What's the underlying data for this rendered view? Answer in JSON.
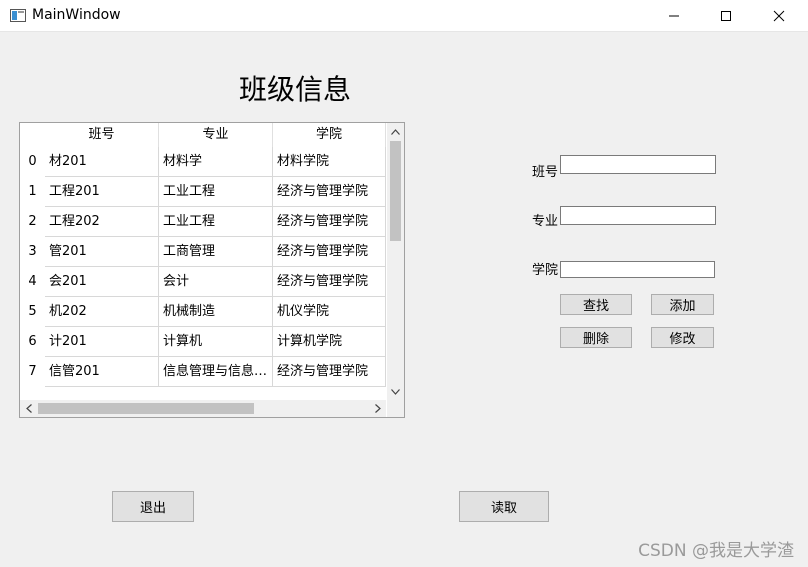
{
  "window": {
    "title": "MainWindow"
  },
  "heading": "班级信息",
  "table": {
    "headers": [
      "班号",
      "专业",
      "学院"
    ],
    "rows": [
      {
        "index": "0",
        "cells": [
          "材201",
          "材料学",
          "材料学院"
        ]
      },
      {
        "index": "1",
        "cells": [
          "工程201",
          "工业工程",
          "经济与管理学院"
        ]
      },
      {
        "index": "2",
        "cells": [
          "工程202",
          "工业工程",
          "经济与管理学院"
        ]
      },
      {
        "index": "3",
        "cells": [
          "管201",
          "工商管理",
          "经济与管理学院"
        ]
      },
      {
        "index": "4",
        "cells": [
          "会201",
          "会计",
          "经济与管理学院"
        ]
      },
      {
        "index": "5",
        "cells": [
          "机202",
          "机械制造",
          "机仪学院"
        ]
      },
      {
        "index": "6",
        "cells": [
          "计201",
          "计算机",
          "计算机学院"
        ]
      },
      {
        "index": "7",
        "cells": [
          "信管201",
          "信息管理与信息系统",
          "经济与管理学院"
        ]
      }
    ]
  },
  "form": {
    "class_label": "班号",
    "major_label": "专业",
    "college_label": "学院",
    "class_value": "",
    "major_value": "",
    "college_value": ""
  },
  "buttons": {
    "search": "查找",
    "add": "添加",
    "delete": "删除",
    "modify": "修改",
    "exit": "退出",
    "read": "读取"
  },
  "watermark": "CSDN @我是大学渣"
}
